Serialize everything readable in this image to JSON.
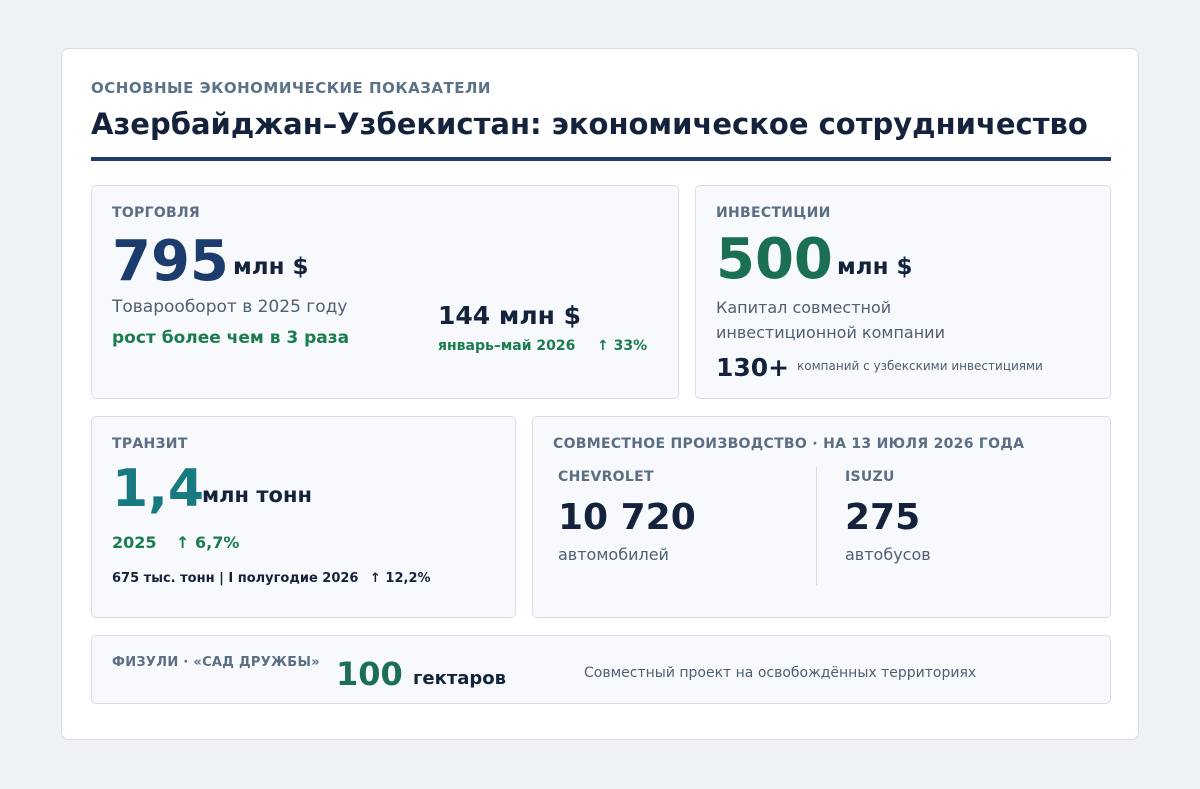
{
  "header": {
    "kicker": "ОСНОВНЫЕ ЭКОНОМИЧЕСКИЕ ПОКАЗАТЕЛИ",
    "title": "Азербайджан–Узбекистан: экономическое сотрудничество"
  },
  "trade": {
    "label": "ТОРГОВЛЯ",
    "value": "795",
    "unit": "млн $",
    "description": "Товарооборот в 2025 году",
    "growth": "рост более чем в 3 раза",
    "secondary_value": "144 млн $",
    "secondary_period": "январь–май 2026",
    "secondary_change": "↑ 33%"
  },
  "investment": {
    "label": "ИНВЕСТИЦИИ",
    "value": "500",
    "unit": "млн $",
    "description_line1": "Капитал совместной",
    "description_line2": "инвестиционной компании",
    "companies_count": "130+",
    "companies_text": "компаний с узбекскими инвестициями"
  },
  "transit": {
    "label": "ТРАНЗИТ",
    "value": "1,4",
    "unit": "млн тонн",
    "year": "2025",
    "year_change": "↑ 6,7%",
    "half_year": "675 тыс. тонн | I полугодие 2026",
    "half_year_change": "↑ 12,2%"
  },
  "production": {
    "label": "СОВМЕСТНОЕ ПРОИЗВОДСТВО · НА 13 ИЮЛЯ 2026 ГОДА",
    "chevrolet": {
      "brand": "CHEVROLET",
      "value": "10 720",
      "unit": "автомобилей"
    },
    "isuzu": {
      "brand": "ISUZU",
      "value": "275",
      "unit": "автобусов"
    }
  },
  "fuzuli": {
    "label": "ФИЗУЛИ · «САД ДРУЖБЫ»",
    "value": "100",
    "unit": "гектаров",
    "description": "Совместный проект на освобождённых территориях"
  },
  "colors": {
    "navy": "#1c3c6e",
    "green": "#1b6f52",
    "teal": "#177a80",
    "accent_green": "#1b7c4f"
  }
}
